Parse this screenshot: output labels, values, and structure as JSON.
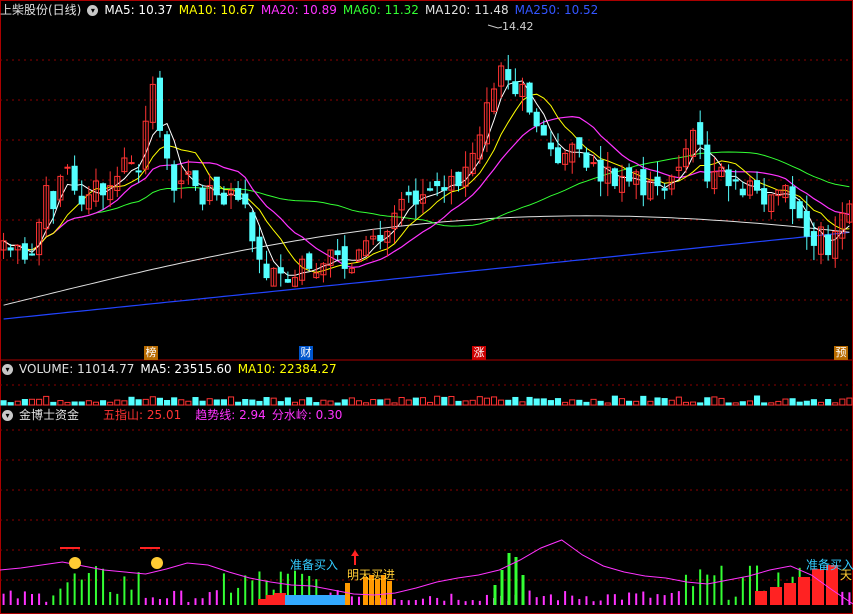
{
  "price_header": {
    "title": "上柴股份(日线)",
    "ma": [
      {
        "label": "MA5: 10.37",
        "color": "#ffffff"
      },
      {
        "label": "MA10: 10.67",
        "color": "#ffff00"
      },
      {
        "label": "MA20: 10.89",
        "color": "#ff33ff"
      },
      {
        "label": "MA60: 11.32",
        "color": "#33ff33"
      },
      {
        "label": "MA120: 11.48",
        "color": "#e0e0e0"
      },
      {
        "label": "MA250: 10.52",
        "color": "#3355ff"
      }
    ],
    "high_label": "14.42"
  },
  "events": [
    {
      "text": "榜",
      "color": "#b86b00"
    },
    {
      "text": "财",
      "color": "#0055cc"
    },
    {
      "text": "涨",
      "color": "#cc0000"
    },
    {
      "text": "预",
      "color": "#b86b00"
    }
  ],
  "volume_header": {
    "title": "VOLUME: 11014.77",
    "ma5": "MA5: 23515.60",
    "ma10": "MA10: 22384.27"
  },
  "indicator_header": {
    "title": "金博士资金",
    "wuzhishan": "五指山: 25.01",
    "qushixian": "趋势线: 2.94",
    "fenshuiling": "分水岭: 0.30"
  },
  "annotations": {
    "zhunbei1": "准备买入",
    "mingtian": "明天买进",
    "zhunbei2": "准备买入",
    "tian": "天"
  },
  "colors": {
    "up": "#ff3333",
    "down": "#54ffff",
    "grid": "#8b0000"
  },
  "chart_data": {
    "type": "candlestick",
    "y_range": [
      8.0,
      15.0
    ],
    "closes": [
      10.2,
      10.0,
      10.1,
      9.8,
      9.9,
      10.6,
      11.4,
      10.9,
      11.6,
      11.8,
      11.3,
      11.0,
      11.2,
      11.5,
      11.2,
      11.4,
      11.6,
      12.0,
      11.9,
      11.7,
      12.8,
      13.6,
      12.6,
      12.0,
      11.3,
      11.5,
      11.7,
      11.4,
      11.0,
      11.4,
      11.2,
      11.0,
      11.3,
      11.1,
      11.0,
      10.2,
      9.8,
      9.4,
      9.6,
      9.5,
      9.3,
      9.4,
      9.8,
      9.6,
      9.5,
      9.7,
      10.0,
      9.9,
      9.6,
      9.6,
      10.0,
      10.2,
      10.3,
      10.2,
      10.4,
      10.8,
      11.1,
      11.2,
      11.0,
      11.2,
      11.3,
      11.4,
      11.3,
      11.6,
      11.4,
      11.8,
      12.1,
      12.5,
      13.2,
      13.5,
      14.0,
      13.7,
      13.4,
      13.6,
      13.0,
      12.7,
      12.5,
      12.2,
      11.9,
      12.1,
      12.3,
      12.2,
      11.8,
      11.9,
      11.5,
      11.8,
      11.4,
      11.6,
      11.5,
      11.7,
      11.2,
      11.5,
      11.4,
      11.3,
      11.6,
      11.8,
      12.2,
      12.6,
      12.3,
      11.5,
      11.7,
      11.8,
      11.4,
      11.5,
      11.2,
      11.5,
      11.3,
      11.0,
      11.2,
      11.3,
      11.4,
      10.9,
      10.7,
      10.3,
      10.1,
      10.5,
      9.9,
      10.4,
      10.8,
      11.0
    ],
    "volume_header_values": {
      "volume": 11014.77,
      "ma5": 23515.6,
      "ma10": 22384.27
    }
  }
}
